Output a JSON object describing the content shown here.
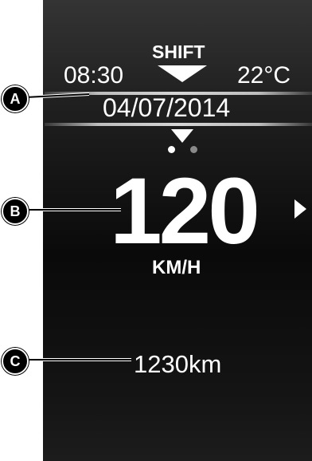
{
  "header": {
    "time": "08:30",
    "shift_label": "SHIFT",
    "temperature": "22°C",
    "date": "04/07/2014"
  },
  "pager": {
    "page_count": 2,
    "active_page": 1
  },
  "speed": {
    "value": "120",
    "unit": "KM/H"
  },
  "odometer": {
    "value": "1230km"
  },
  "callouts": {
    "a": "A",
    "b": "B",
    "c": "C"
  },
  "colors": {
    "text": "#ffffff",
    "screen_dark": "#0a0a0a",
    "inactive_dot": "#8a8a8a"
  },
  "icons": {
    "shift": "shift-down-triangle-icon",
    "mode": "mode-selector-triangle-icon",
    "next": "next-page-right-arrow-icon"
  }
}
